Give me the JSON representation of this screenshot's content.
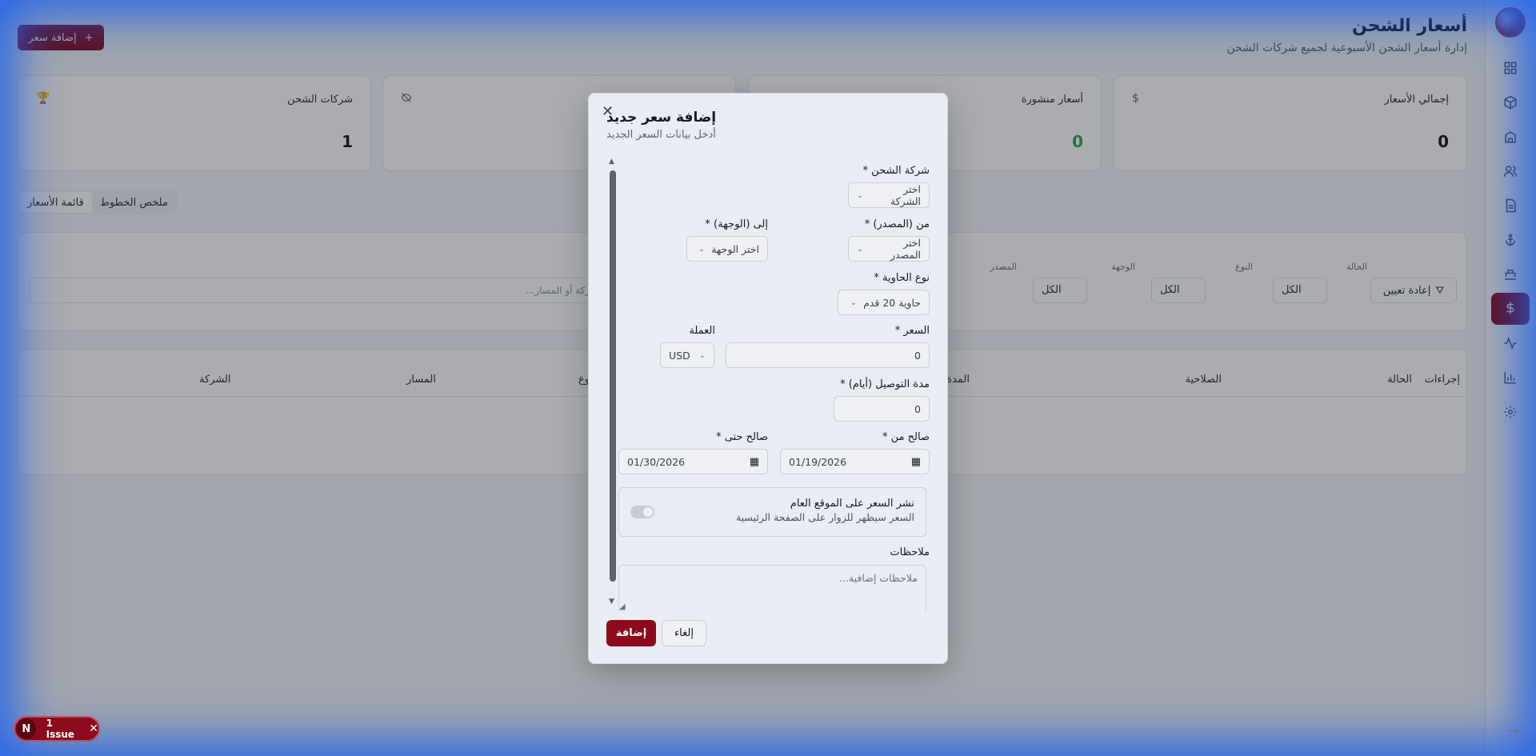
{
  "header": {
    "title": "أسعار الشحن",
    "subtitle": "إدارة أسعار الشحن الأسبوعية لجميع شركات الشحن",
    "add_button": "إضافة سعر",
    "add_icon": "+"
  },
  "stats": [
    {
      "label": "إجمالي الأسعار",
      "value": "0",
      "icon": "$"
    },
    {
      "label": "أسعار منشورة",
      "value": "0",
      "icon": ""
    },
    {
      "label": "",
      "value": "",
      "icon": "eye-off"
    },
    {
      "label": "شركات الشحن",
      "value": "1",
      "icon": "trophy"
    }
  ],
  "tabs": [
    "ملخص الخطوط",
    "قائمة الأسعار"
  ],
  "filters": {
    "search_placeholder": "بحث بالشركة أو المسار...",
    "status_label": "الحالة",
    "type_label": "النوع",
    "destination_label": "الوجهة",
    "source_label": "المصدر",
    "all": "الكل",
    "reset": "إعادة تعيين"
  },
  "table": {
    "headers": [
      "إجراءات",
      "الحالة",
      "الصلاحية",
      "المدة",
      "وع",
      "المسار",
      "الشركة"
    ]
  },
  "modal": {
    "title": "إضافة سعر جديد",
    "description": "أدخل بيانات السعر الجديد",
    "company_label": "شركة الشحن *",
    "company_placeholder": "اختر الشركة",
    "from_label": "من (المصدر) *",
    "from_placeholder": "اختر المصدر",
    "to_label": "إلى (الوجهة) *",
    "to_placeholder": "اختر الوجهة",
    "container_label": "نوع الحاوية *",
    "container_value": "حاوية 20 قدم",
    "price_label": "السعر *",
    "price_value": "0",
    "currency_label": "العملة",
    "currency_value": "USD",
    "duration_label": "مدة التوصيل (أيام) *",
    "duration_value": "0",
    "valid_from_label": "صالح من *",
    "valid_from_value": "01/19/2026",
    "valid_to_label": "صالح حتى *",
    "valid_to_value": "01/30/2026",
    "publish_title": "نشر السعر على الموقع العام",
    "publish_desc": "السعر سيظهر للزوار على الصفحة الرئيسية",
    "notes_label": "ملاحظات",
    "notes_placeholder": "ملاحظات إضافية...",
    "submit": "إضافة",
    "cancel": "إلغاء"
  },
  "issue": {
    "avatar": "N",
    "label": "1 Issue"
  },
  "colors": {
    "brand": "#8c0a1c",
    "accent_green": "#2fa84f",
    "frame_blue": "#1f62eb"
  }
}
